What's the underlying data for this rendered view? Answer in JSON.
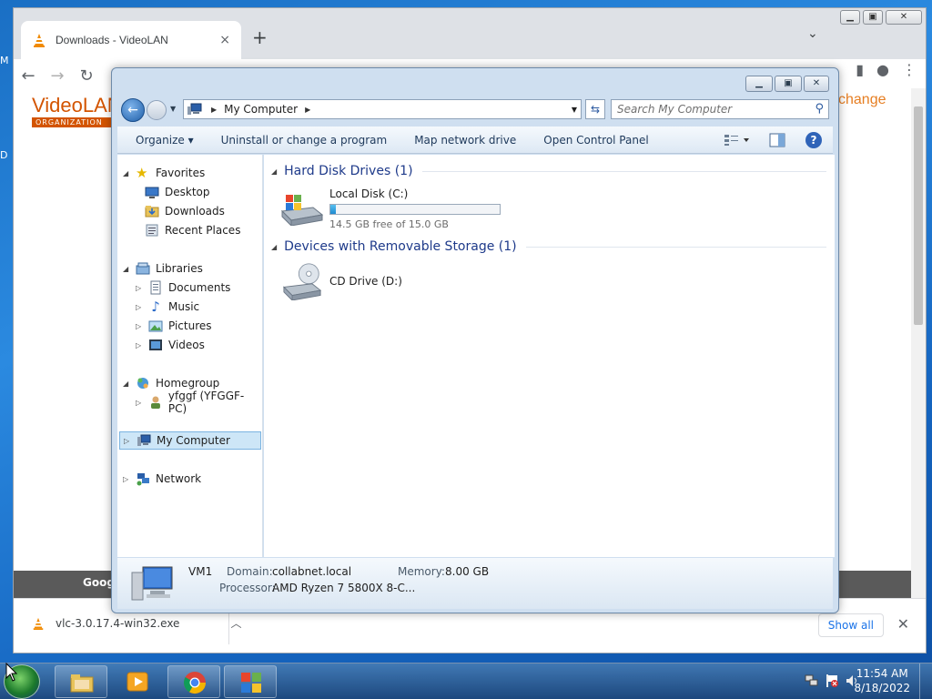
{
  "desktop": {
    "fragments": [
      "M",
      "D"
    ]
  },
  "chrome": {
    "tab_title": "Downloads - VideoLAN",
    "tab_close": "×",
    "new_tab": "+",
    "page": {
      "logo_main": "VideoLAN",
      "logo_sub": "ORGANIZATION",
      "change_link": "change",
      "footer_text": "Goog"
    },
    "download": {
      "filename": "vlc-3.0.17.4-win32.exe",
      "show_all": "Show all"
    }
  },
  "explorer": {
    "address": "My Computer",
    "search_placeholder": "Search My Computer",
    "commands": [
      "Organize",
      "Uninstall or change a program",
      "Map network drive",
      "Open Control Panel"
    ],
    "nav": {
      "favorites": "Favorites",
      "desktop": "Desktop",
      "downloads": "Downloads",
      "recent": "Recent Places",
      "libraries": "Libraries",
      "documents": "Documents",
      "music": "Music",
      "pictures": "Pictures",
      "videos": "Videos",
      "homegroup": "Homegroup",
      "user": "yfggf (YFGGF-PC)",
      "computer": "My Computer",
      "network": "Network"
    },
    "groups": {
      "hdd": "Hard Disk Drives (1)",
      "removable": "Devices with Removable Storage (1)"
    },
    "drives": {
      "c_name": "Local Disk (C:)",
      "c_free": "14.5 GB free of 15.0 GB",
      "c_used_fraction": 0.033,
      "d_name": "CD Drive (D:)"
    },
    "details": {
      "name": "VM1",
      "domain_label": "Domain:",
      "domain_value": "collabnet.local",
      "memory_label": "Memory:",
      "memory_value": "8.00 GB",
      "processor_label": "Processor:",
      "processor_value": "AMD Ryzen 7 5800X 8-C..."
    }
  },
  "taskbar": {
    "time": "11:54 AM",
    "date": "8/18/2022"
  }
}
